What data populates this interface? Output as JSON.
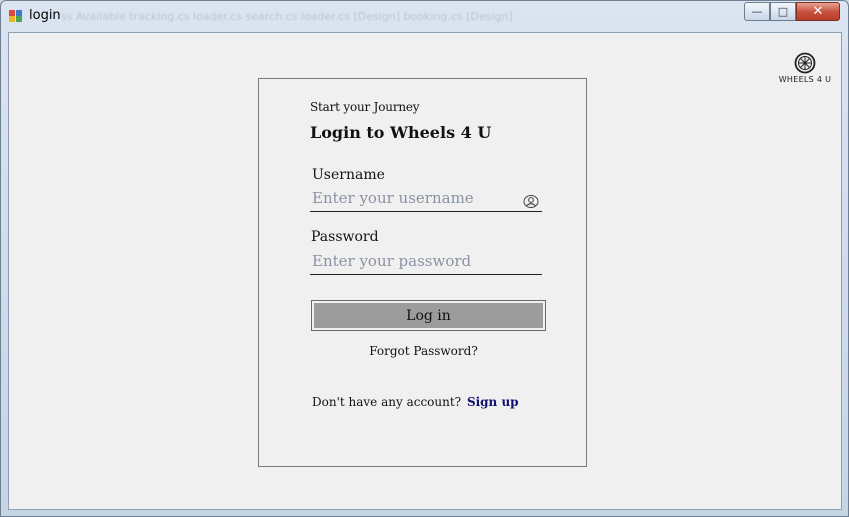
{
  "window": {
    "title": "login",
    "ghost_tabs": "ss Available        tracking.cs        loader.cs        search.cs        loader.cs [Design]        booking.cs [Design]",
    "minimize_symbol": "—",
    "maximize_symbol": "□",
    "close_symbol": "✕"
  },
  "brand": {
    "logo_icon": "wheel-icon",
    "name": "WHEELS 4 U"
  },
  "login": {
    "kicker": "Start your Journey",
    "heading": "Login to Wheels 4 U",
    "username_label": "Username",
    "username_placeholder": "Enter your username",
    "username_value": "",
    "username_icon": "user-circle-icon",
    "password_label": "Password",
    "password_placeholder": "Enter your password",
    "password_value": "",
    "login_button": "Log in",
    "forgot_link": "Forgot Password?",
    "signup_prompt": "Don't have any account?",
    "signup_link": "Sign up"
  },
  "colors": {
    "background": "#f0f0f0",
    "button": "#9c9c9c",
    "link": "#101070",
    "placeholder": "#8a93a3"
  }
}
